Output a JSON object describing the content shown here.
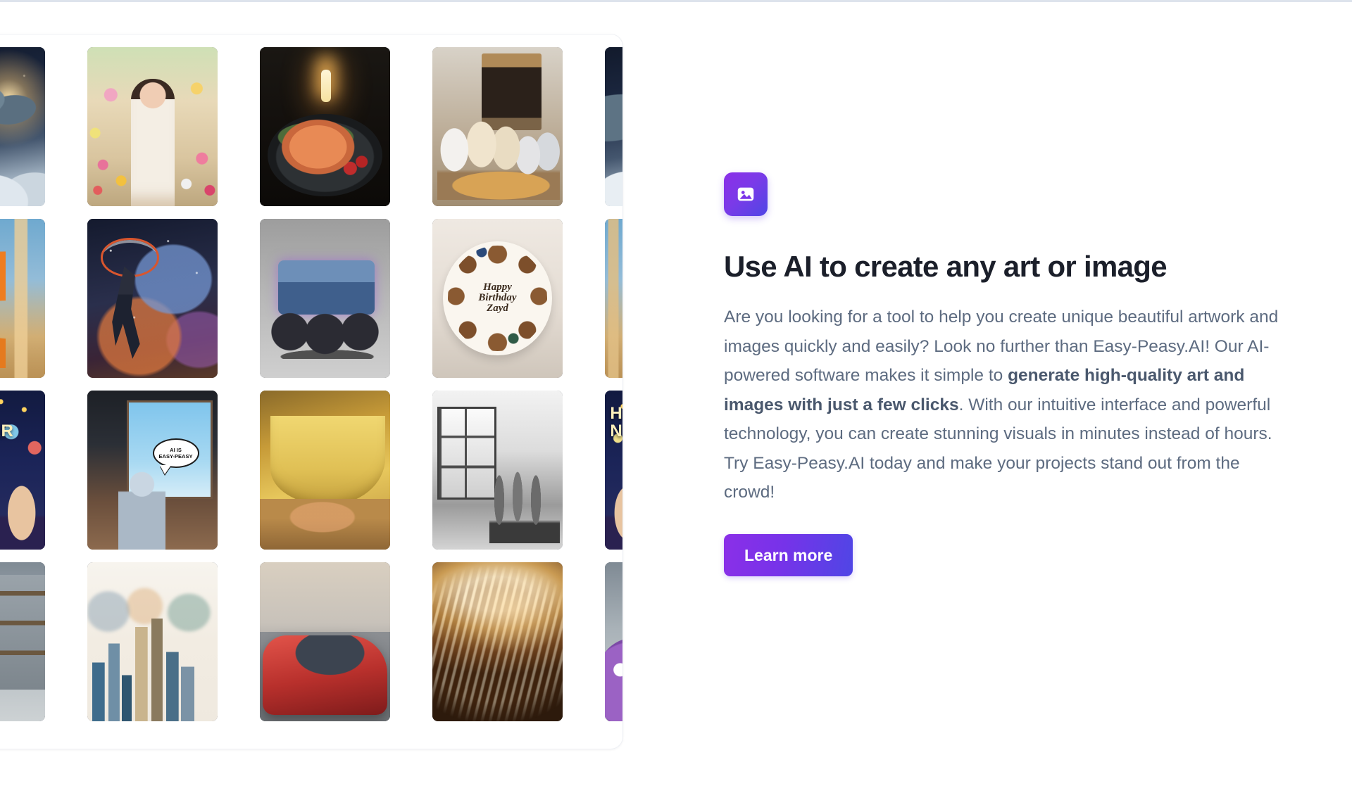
{
  "section": {
    "icon_name": "image-icon",
    "headline": "Use AI to create any art or image",
    "body_part_1": "Are you looking for a tool to help you create unique beautiful artwork and images quickly and easily? Look no further than Easy-Peasy.AI! Our AI-powered software makes it simple to ",
    "body_bold": "generate high-quality art and images with just a few clicks",
    "body_part_2": ". With our intuitive interface and powerful technology, you can create stunning visuals in minutes instead of hours. Try Easy-Peasy.AI today and make your projects stand out from the crowd!",
    "cta_label": "Learn more"
  },
  "colors": {
    "accent_purple": "#8b2fe8",
    "accent_indigo": "#4f46e5",
    "heading": "#1b1f2a",
    "body_text": "#5d6b80",
    "card_border": "#eef0f4"
  },
  "gallery": {
    "columns": 5,
    "rows": 4,
    "tiles": [
      {
        "name": "dragon-in-clouds",
        "art": "art-dragon",
        "alt": "Silver dragon flying through starry clouds"
      },
      {
        "name": "woman-in-flower-garden",
        "art": "art-hanbok",
        "alt": "Smiling woman in hanbok holding a flower basket in a garden"
      },
      {
        "name": "salmon-dish",
        "art": "art-salmon",
        "alt": "Grilled salmon with rosemary and tomatoes by candlelight"
      },
      {
        "name": "puppies-with-guitar",
        "art": "art-puppies",
        "alt": "Puppies sitting with an acoustic guitar by a fireplace"
      },
      {
        "name": "dragon-in-clouds-repeat",
        "art": "art-dragon",
        "alt": "Silver dragon flying through starry clouds"
      },
      {
        "name": "giraffe-city-painting",
        "art": "art-giraffe",
        "alt": "Painterly giraffe in front of a city skyline"
      },
      {
        "name": "basketball-cosmos",
        "art": "art-bball",
        "alt": "Basketball player dunking inside a cosmic nebula"
      },
      {
        "name": "monster-truck",
        "art": "art-truck",
        "alt": "Blue and purple monster truck on a grey backdrop"
      },
      {
        "name": "birthday-cake",
        "art": "art-cake",
        "cake_text": "Happy\nBirthday\nZayd",
        "alt": "Decorated birthday cake with piped frosting"
      },
      {
        "name": "giraffe-city-painting-repeat",
        "art": "art-giraffe",
        "alt": "Painterly giraffe in front of a city skyline"
      },
      {
        "name": "happy-new-year-party",
        "art": "art-nye",
        "nye_text": "HAPPY\nNEW YEAR",
        "alt": "Friends celebrating New Year with champagne"
      },
      {
        "name": "robot-comic-cafe",
        "art": "art-robot",
        "bubble_text": "AI IS\nEASY-PEASY",
        "alt": "Comic style robot in a cafe with a speech bubble"
      },
      {
        "name": "banana-bedroom",
        "art": "art-banana",
        "alt": "Giant banana shaped bed in a sunlit room"
      },
      {
        "name": "black-white-interior",
        "art": "art-bw",
        "alt": "Black and white dining room interior"
      },
      {
        "name": "happy-new-year-party-repeat",
        "art": "art-nye",
        "nye_text": "HAPPY\nNEW YEAR",
        "alt": "Friends celebrating New Year with champagne"
      },
      {
        "name": "purple-monkey-cafe",
        "art": "art-monkey",
        "alt": "Purple cartoon monkey with coffee in a cafe"
      },
      {
        "name": "watercolor-city-skyline",
        "art": "art-city",
        "alt": "Watercolor painting of a city skyline"
      },
      {
        "name": "red-sports-car",
        "art": "art-car",
        "alt": "Red sports car speeding down a road"
      },
      {
        "name": "golden-bread-texture",
        "art": "art-bread",
        "alt": "Close-up golden baked bread texture"
      },
      {
        "name": "purple-monkey-cafe-repeat",
        "art": "art-monkey",
        "alt": "Purple cartoon monkey with coffee in a cafe"
      }
    ]
  }
}
